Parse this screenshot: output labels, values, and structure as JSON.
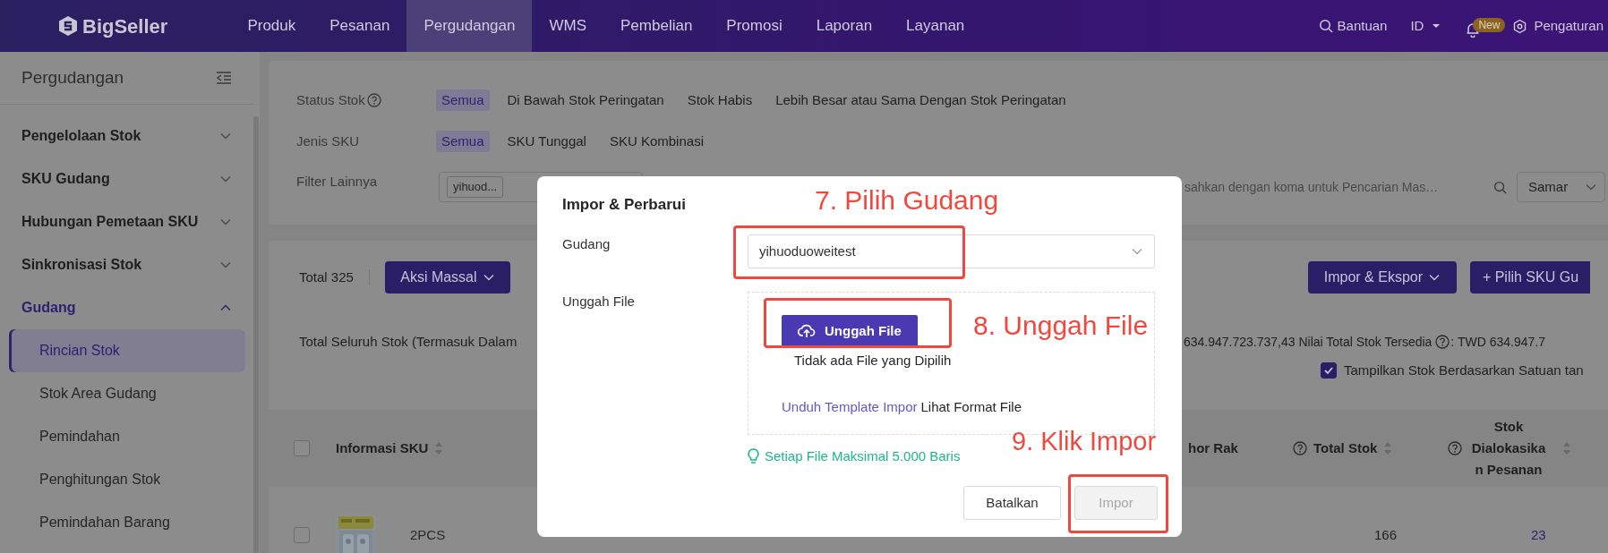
{
  "header": {
    "logo": "BigSeller",
    "nav": [
      {
        "label": "Produk",
        "selected": false
      },
      {
        "label": "Pesanan",
        "selected": false
      },
      {
        "label": "Pergudangan",
        "selected": true
      },
      {
        "label": "WMS",
        "selected": false
      },
      {
        "label": "Pembelian",
        "selected": false
      },
      {
        "label": "Promosi",
        "selected": false
      },
      {
        "label": "Laporan",
        "selected": false
      },
      {
        "label": "Layanan",
        "selected": false
      }
    ],
    "help": "Bantuan",
    "language": "ID",
    "badge": "New",
    "settings": "Pengaturan"
  },
  "sidebar": {
    "title": "Pergudangan",
    "items": [
      {
        "label": "Pengelolaan Stok",
        "expanded": false
      },
      {
        "label": "SKU Gudang",
        "expanded": false
      },
      {
        "label": "Hubungan Pemetaan SKU",
        "expanded": false
      },
      {
        "label": "Sinkronisasi Stok",
        "expanded": false
      },
      {
        "label": "Gudang",
        "expanded": true,
        "children": [
          {
            "label": "Rincian Stok",
            "selected": true
          },
          {
            "label": "Stok Area Gudang",
            "selected": false
          },
          {
            "label": "Pemindahan",
            "selected": false
          },
          {
            "label": "Penghitungan Stok",
            "selected": false
          },
          {
            "label": "Pemindahan Barang",
            "selected": false
          }
        ]
      }
    ]
  },
  "filters": {
    "rows": [
      {
        "label": "Status Stok",
        "help": true,
        "options": [
          {
            "label": "Semua",
            "selected": true
          },
          {
            "label": "Di Bawah Stok Peringatan",
            "selected": false
          },
          {
            "label": "Stok Habis",
            "selected": false
          },
          {
            "label": "Lebih Besar atau Sama Dengan Stok Peringatan",
            "selected": false
          }
        ]
      },
      {
        "label": "Jenis SKU",
        "help": false,
        "options": [
          {
            "label": "Semua",
            "selected": true
          },
          {
            "label": "SKU Tunggal",
            "selected": false
          },
          {
            "label": "SKU Kombinasi",
            "selected": false
          }
        ]
      }
    ],
    "other": {
      "label": "Filter Lainnya",
      "tag": "yihuod...",
      "search_placeholder": "sahkan dengan koma untuk Pencarian Mas…",
      "match_mode": "Samar"
    }
  },
  "toolbar": {
    "total": "Total 325",
    "bulk_action": "Aksi Massal",
    "import_export": "Impor & Ekspor",
    "add": "+ Pilih SKU Gu"
  },
  "summary": {
    "left": "Total Seluruh Stok (Termasuk Dalam",
    "right": "634.947.723.737,43 Nilai Total Stok Tersedia",
    "right_after_help": ": TWD 634.947.7"
  },
  "unit_toggle": {
    "label": "Tampilkan Stok Berdasarkan Satuan tan",
    "checked": true
  },
  "table": {
    "all_selected": false,
    "columns": [
      {
        "label": "Informasi SKU",
        "help": false,
        "sortable": true
      },
      {
        "label": "hor Rak",
        "help": false,
        "sortable": false
      },
      {
        "label": "Total Stok",
        "help": true,
        "sortable": true
      },
      {
        "label": "Stok Dialokasikan Pesanan",
        "help": true,
        "sortable": true
      }
    ],
    "rows": [
      {
        "selected": false,
        "kind": "picture",
        "sku": "2PCS",
        "total_stock": "166",
        "allocated": "23"
      }
    ]
  },
  "dialog": {
    "title": "Impor & Perbarui",
    "warehouse_label": "Gudang",
    "warehouse_value": "yihuoduoweitest",
    "file_label": "Unggah File",
    "upload_button": "Unggah File",
    "no_file": "Tidak ada File yang Dipilih",
    "template_link": "Unduh Template Impor",
    "format_link": "Lihat Format File",
    "hint": "Setiap File Maksimal 5.000 Baris",
    "buttons": [
      {
        "label": "Batalkan",
        "disabled": false
      },
      {
        "label": "Impor",
        "disabled": true
      }
    ]
  },
  "annotations": [
    {
      "text": "7. Pilih Gudang"
    },
    {
      "text": "8. Unggah File"
    },
    {
      "text": "9. Klik Impor"
    }
  ]
}
